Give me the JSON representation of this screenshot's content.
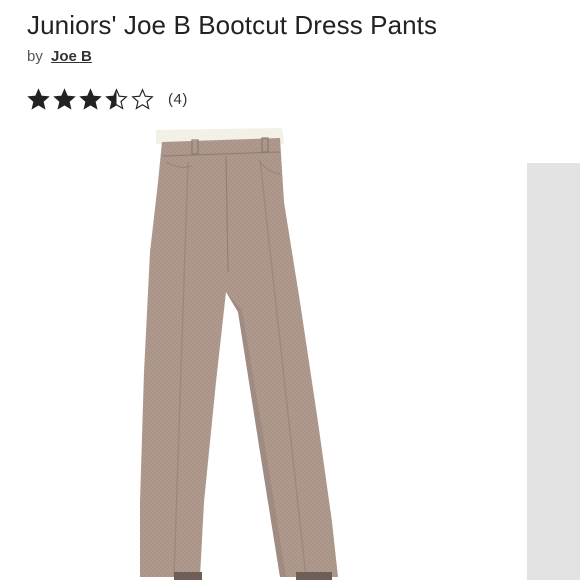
{
  "product": {
    "title": "Juniors' Joe B Bootcut Dress Pants",
    "by_prefix": "by",
    "brand": "Joe B",
    "rating": 3.5,
    "rating_max": 5,
    "review_count": "(4)"
  },
  "icons": {
    "star_filled": "star-filled-icon",
    "star_half": "star-half-icon",
    "star_empty": "star-empty-icon"
  },
  "colors": {
    "pants": "#b09a8e",
    "pants_shadow": "#94807a",
    "waistband_cream": "#f3f0e8",
    "gallery_panel": "#e3e3e3",
    "star": "#222222"
  }
}
